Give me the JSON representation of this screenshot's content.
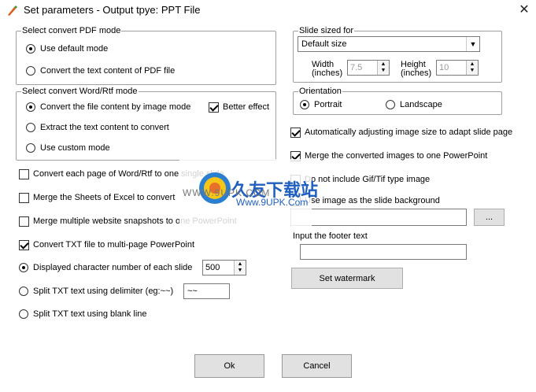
{
  "window": {
    "title": "Set parameters - Output tpye: PPT File",
    "close_glyph": "✕"
  },
  "pdf_mode": {
    "legend": "Select convert PDF mode",
    "options": [
      "Use default mode",
      "Convert the text content of PDF file"
    ],
    "selected": 0
  },
  "word_mode": {
    "legend": "Select convert Word/Rtf mode",
    "options": [
      "Convert the file content by image mode",
      "Extract the text content to convert",
      "Use custom mode"
    ],
    "selected": 0,
    "better_effect_label": "Better effect",
    "better_effect_checked": true
  },
  "left_checks": {
    "each_page": "Convert each page of Word/Rtf to one single slide",
    "merge_sheets": "Merge the Sheets of Excel to convert",
    "merge_snapshots": "Merge multiple website snapshots to one PowerPoint",
    "txt_multi": "Convert TXT file to multi-page PowerPoint"
  },
  "txt_split": {
    "char_count_label": "Displayed character number of each slide",
    "char_count_value": "500",
    "delimiter_label": "Split TXT text using delimiter (eg:~~)",
    "delimiter_value": "~~",
    "blank_line_label": "Split TXT text using blank line"
  },
  "slide_size": {
    "legend": "Slide sized for",
    "selected": "Default size",
    "width_label_1": "Width",
    "width_label_2": "(inches)",
    "width_value": "7.5",
    "height_label_1": "Height",
    "height_label_2": "(inches)",
    "height_value": "10"
  },
  "orientation": {
    "legend": "Orientation",
    "portrait": "Portrait",
    "landscape": "Landscape"
  },
  "right_checks": {
    "auto_adjust": "Automatically adjusting image size to adapt slide page",
    "merge_images": "Merge the converted images to one PowerPoint",
    "gif_tif": "Do not include Gif/Tif type image",
    "bg_image": "Use image as the slide background"
  },
  "browse_label": "...",
  "footer_label": "Input the footer text",
  "footer_value": "",
  "watermark_label": "Set watermark",
  "ok_label": "Ok",
  "cancel_label": "Cancel",
  "watermark_overlay": {
    "text_cn": "久友下载站",
    "text_url": "WWW.9UPK.COM",
    "text_url2": "Www.9UPK.Com"
  }
}
